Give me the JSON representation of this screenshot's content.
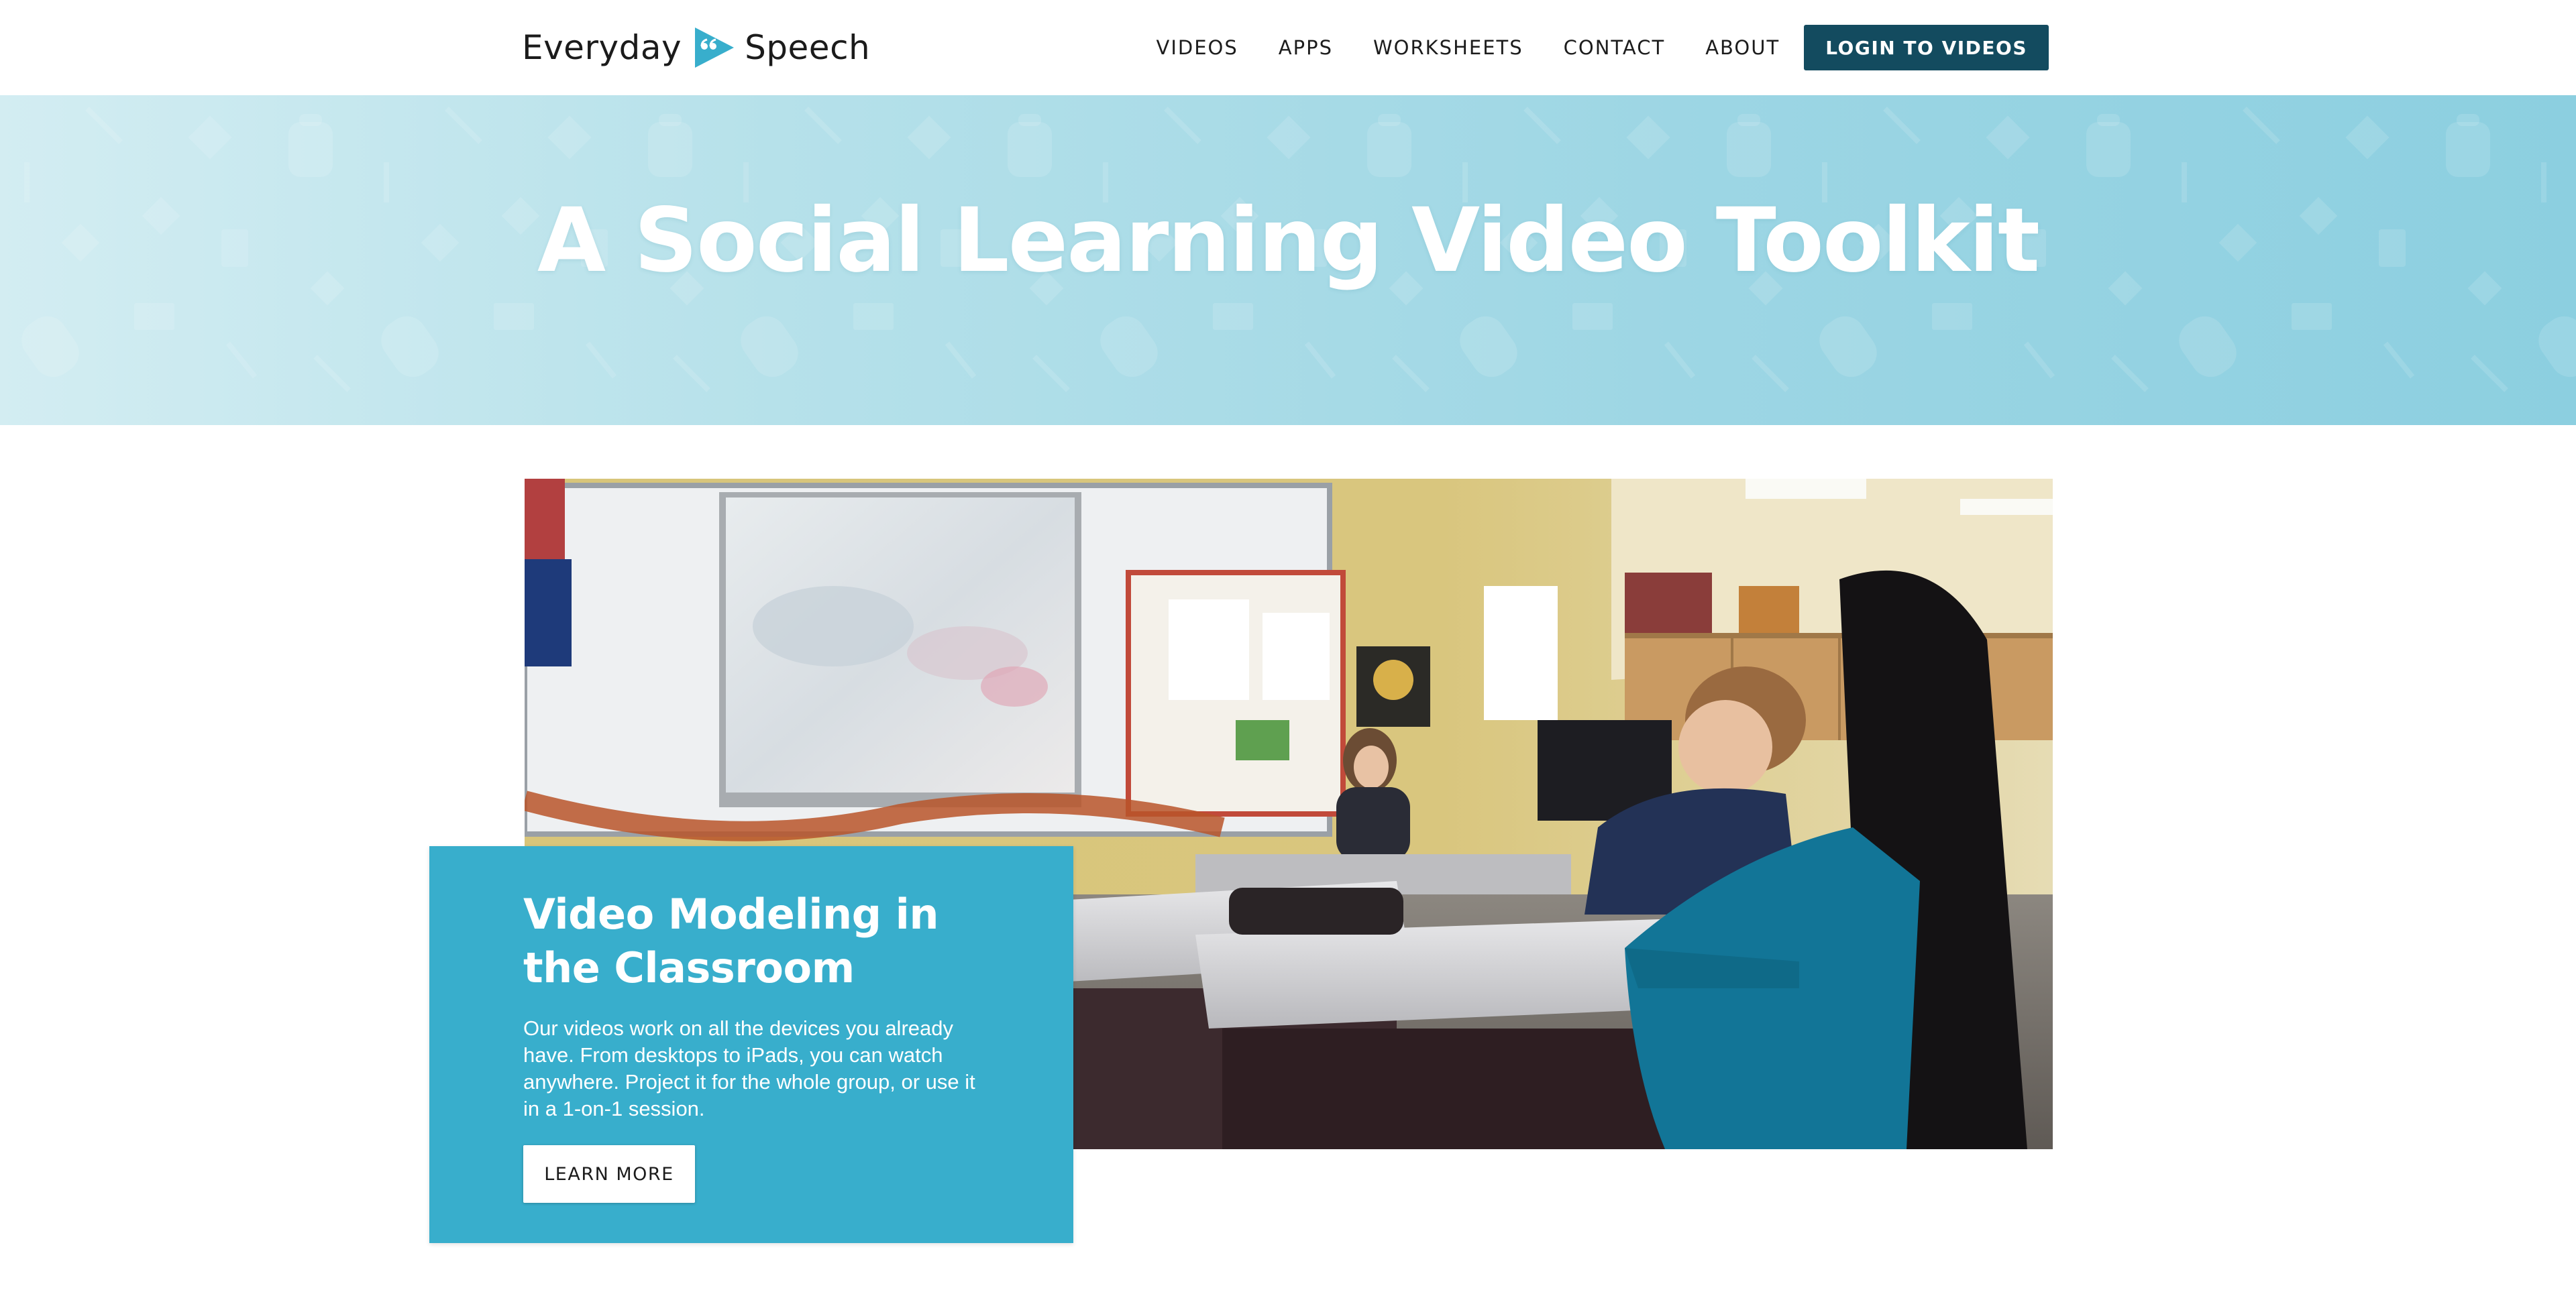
{
  "brand": {
    "name_left": "Everyday",
    "name_right": "Speech",
    "logo_icon": "play-quote-icon",
    "accent": "#38aecc"
  },
  "nav": {
    "items": [
      {
        "label": "VIDEOS"
      },
      {
        "label": "APPS"
      },
      {
        "label": "WORKSHEETS"
      },
      {
        "label": "CONTACT"
      },
      {
        "label": "ABOUT"
      }
    ],
    "login_label": "LOGIN TO VIDEOS",
    "login_color": "#134b5f"
  },
  "hero": {
    "title": "A Social Learning Video Toolkit",
    "background": "#9dd6e4"
  },
  "feature": {
    "title": "Video Modeling in the Classroom",
    "description": "Our videos work on all the devices you already have. From desktops to iPads, you can watch anywhere. Project it for the whole group, or use it in a 1-on-1 session.",
    "button_label": "LEARN MORE",
    "card_color": "#38aecc"
  }
}
